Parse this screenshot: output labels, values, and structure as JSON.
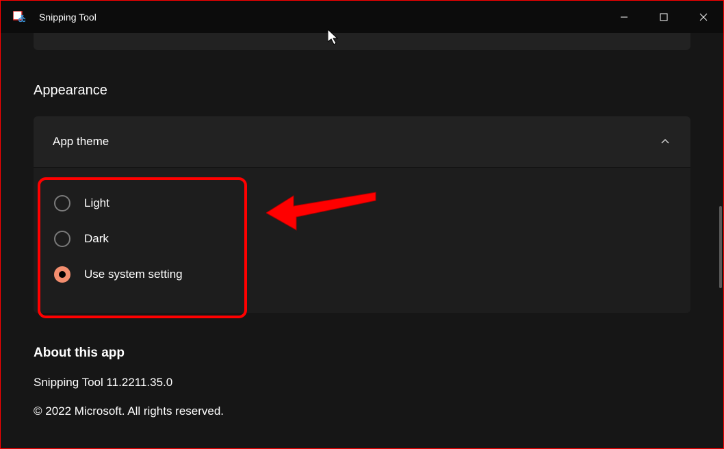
{
  "titlebar": {
    "title": "Snipping Tool"
  },
  "appearance": {
    "heading": "Appearance",
    "app_theme": {
      "label": "App theme",
      "options": [
        {
          "label": "Light",
          "selected": false
        },
        {
          "label": "Dark",
          "selected": false
        },
        {
          "label": "Use system setting",
          "selected": true
        }
      ]
    }
  },
  "about": {
    "heading": "About this app",
    "version": "Snipping Tool 11.2211.35.0",
    "copyright": "© 2022 Microsoft. All rights reserved."
  }
}
